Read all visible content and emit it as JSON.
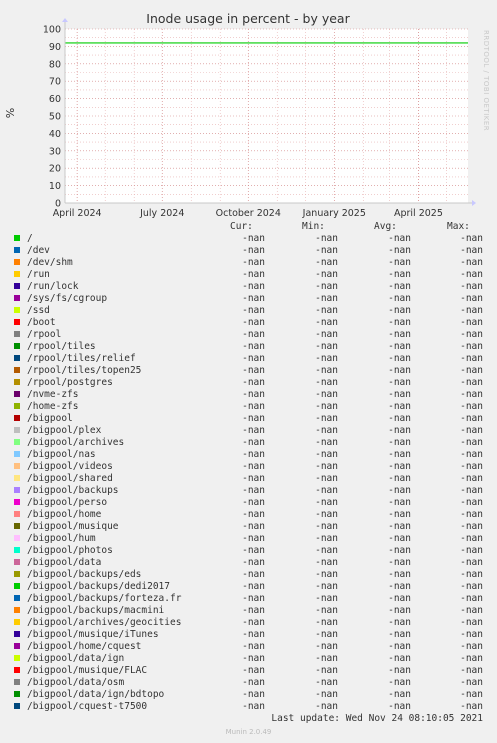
{
  "chart_data": {
    "type": "line",
    "title": "Inode usage in percent - by year",
    "ylabel": "%",
    "xlabel": "",
    "ylim": [
      0,
      100
    ],
    "y_ticks": [
      0,
      10,
      20,
      30,
      40,
      50,
      60,
      70,
      80,
      90,
      100
    ],
    "xlim": [
      "2024-03-19",
      "2025-05-24"
    ],
    "x_ticks": [
      {
        "date": "2024-04-01",
        "label": "April 2024"
      },
      {
        "date": "2024-07-01",
        "label": "July 2024"
      },
      {
        "date": "2024-10-01",
        "label": "October 2024"
      },
      {
        "date": "2025-01-01",
        "label": "January 2025"
      },
      {
        "date": "2025-04-01",
        "label": "April 2025"
      }
    ],
    "grid": true,
    "series": [
      {
        "name": "/",
        "color": "#00cc00",
        "x": [
          "2024-03-19",
          "2025-05-24"
        ],
        "values": [
          92,
          92
        ]
      }
    ]
  },
  "watermark": "RRDTOOL / TOBI OETIKER",
  "legend": {
    "headers": {
      "cur": "Cur:",
      "min": "Min:",
      "avg": "Avg:",
      "max": "Max:"
    },
    "rows": [
      {
        "name": "/",
        "color": "#00cc00",
        "cur": "-nan",
        "min": "-nan",
        "avg": "-nan",
        "max": "-nan"
      },
      {
        "name": "/dev",
        "color": "#0066b3",
        "cur": "-nan",
        "min": "-nan",
        "avg": "-nan",
        "max": "-nan"
      },
      {
        "name": "/dev/shm",
        "color": "#ff8000",
        "cur": "-nan",
        "min": "-nan",
        "avg": "-nan",
        "max": "-nan"
      },
      {
        "name": "/run",
        "color": "#ffcc00",
        "cur": "-nan",
        "min": "-nan",
        "avg": "-nan",
        "max": "-nan"
      },
      {
        "name": "/run/lock",
        "color": "#330099",
        "cur": "-nan",
        "min": "-nan",
        "avg": "-nan",
        "max": "-nan"
      },
      {
        "name": "/sys/fs/cgroup",
        "color": "#990099",
        "cur": "-nan",
        "min": "-nan",
        "avg": "-nan",
        "max": "-nan"
      },
      {
        "name": "/ssd",
        "color": "#ccff00",
        "cur": "-nan",
        "min": "-nan",
        "avg": "-nan",
        "max": "-nan"
      },
      {
        "name": "/boot",
        "color": "#ff0000",
        "cur": "-nan",
        "min": "-nan",
        "avg": "-nan",
        "max": "-nan"
      },
      {
        "name": "/rpool",
        "color": "#808080",
        "cur": "-nan",
        "min": "-nan",
        "avg": "-nan",
        "max": "-nan"
      },
      {
        "name": "/rpool/tiles",
        "color": "#008f00",
        "cur": "-nan",
        "min": "-nan",
        "avg": "-nan",
        "max": "-nan"
      },
      {
        "name": "/rpool/tiles/relief",
        "color": "#00487d",
        "cur": "-nan",
        "min": "-nan",
        "avg": "-nan",
        "max": "-nan"
      },
      {
        "name": "/rpool/tiles/topen25",
        "color": "#b35a00",
        "cur": "-nan",
        "min": "-nan",
        "avg": "-nan",
        "max": "-nan"
      },
      {
        "name": "/rpool/postgres",
        "color": "#b38f00",
        "cur": "-nan",
        "min": "-nan",
        "avg": "-nan",
        "max": "-nan"
      },
      {
        "name": "/nvme-zfs",
        "color": "#6b006b",
        "cur": "-nan",
        "min": "-nan",
        "avg": "-nan",
        "max": "-nan"
      },
      {
        "name": "/home-zfs",
        "color": "#8fb300",
        "cur": "-nan",
        "min": "-nan",
        "avg": "-nan",
        "max": "-nan"
      },
      {
        "name": "/bigpool",
        "color": "#b30000",
        "cur": "-nan",
        "min": "-nan",
        "avg": "-nan",
        "max": "-nan"
      },
      {
        "name": "/bigpool/plex",
        "color": "#bebebe",
        "cur": "-nan",
        "min": "-nan",
        "avg": "-nan",
        "max": "-nan"
      },
      {
        "name": "/bigpool/archives",
        "color": "#80ff80",
        "cur": "-nan",
        "min": "-nan",
        "avg": "-nan",
        "max": "-nan"
      },
      {
        "name": "/bigpool/nas",
        "color": "#80c9ff",
        "cur": "-nan",
        "min": "-nan",
        "avg": "-nan",
        "max": "-nan"
      },
      {
        "name": "/bigpool/videos",
        "color": "#ffc080",
        "cur": "-nan",
        "min": "-nan",
        "avg": "-nan",
        "max": "-nan"
      },
      {
        "name": "/bigpool/shared",
        "color": "#ffe680",
        "cur": "-nan",
        "min": "-nan",
        "avg": "-nan",
        "max": "-nan"
      },
      {
        "name": "/bigpool/backups",
        "color": "#aa80ff",
        "cur": "-nan",
        "min": "-nan",
        "avg": "-nan",
        "max": "-nan"
      },
      {
        "name": "/bigpool/perso",
        "color": "#ee00cc",
        "cur": "-nan",
        "min": "-nan",
        "avg": "-nan",
        "max": "-nan"
      },
      {
        "name": "/bigpool/home",
        "color": "#ff8080",
        "cur": "-nan",
        "min": "-nan",
        "avg": "-nan",
        "max": "-nan"
      },
      {
        "name": "/bigpool/musique",
        "color": "#666600",
        "cur": "-nan",
        "min": "-nan",
        "avg": "-nan",
        "max": "-nan"
      },
      {
        "name": "/bigpool/hum",
        "color": "#ffbfff",
        "cur": "-nan",
        "min": "-nan",
        "avg": "-nan",
        "max": "-nan"
      },
      {
        "name": "/bigpool/photos",
        "color": "#00ffcc",
        "cur": "-nan",
        "min": "-nan",
        "avg": "-nan",
        "max": "-nan"
      },
      {
        "name": "/bigpool/data",
        "color": "#cc6699",
        "cur": "-nan",
        "min": "-nan",
        "avg": "-nan",
        "max": "-nan"
      },
      {
        "name": "/bigpool/backups/eds",
        "color": "#999900",
        "cur": "-nan",
        "min": "-nan",
        "avg": "-nan",
        "max": "-nan"
      },
      {
        "name": "/bigpool/backups/dedi2017",
        "color": "#00cc00",
        "cur": "-nan",
        "min": "-nan",
        "avg": "-nan",
        "max": "-nan"
      },
      {
        "name": "/bigpool/backups/forteza.fr",
        "color": "#0066b3",
        "cur": "-nan",
        "min": "-nan",
        "avg": "-nan",
        "max": "-nan"
      },
      {
        "name": "/bigpool/backups/macmini",
        "color": "#ff8000",
        "cur": "-nan",
        "min": "-nan",
        "avg": "-nan",
        "max": "-nan"
      },
      {
        "name": "/bigpool/archives/geocities",
        "color": "#ffcc00",
        "cur": "-nan",
        "min": "-nan",
        "avg": "-nan",
        "max": "-nan"
      },
      {
        "name": "/bigpool/musique/iTunes",
        "color": "#330099",
        "cur": "-nan",
        "min": "-nan",
        "avg": "-nan",
        "max": "-nan"
      },
      {
        "name": "/bigpool/home/cquest",
        "color": "#990099",
        "cur": "-nan",
        "min": "-nan",
        "avg": "-nan",
        "max": "-nan"
      },
      {
        "name": "/bigpool/data/ign",
        "color": "#ccff00",
        "cur": "-nan",
        "min": "-nan",
        "avg": "-nan",
        "max": "-nan"
      },
      {
        "name": "/bigpool/musique/FLAC",
        "color": "#ff0000",
        "cur": "-nan",
        "min": "-nan",
        "avg": "-nan",
        "max": "-nan"
      },
      {
        "name": "/bigpool/data/osm",
        "color": "#808080",
        "cur": "-nan",
        "min": "-nan",
        "avg": "-nan",
        "max": "-nan"
      },
      {
        "name": "/bigpool/data/ign/bdtopo",
        "color": "#008f00",
        "cur": "-nan",
        "min": "-nan",
        "avg": "-nan",
        "max": "-nan"
      },
      {
        "name": "/bigpool/cquest-t7500",
        "color": "#00487d",
        "cur": "-nan",
        "min": "-nan",
        "avg": "-nan",
        "max": "-nan"
      }
    ]
  },
  "footer": {
    "last_update": "Last update: Wed Nov 24 08:10:05 2021",
    "munin": "Munin 2.0.49"
  }
}
